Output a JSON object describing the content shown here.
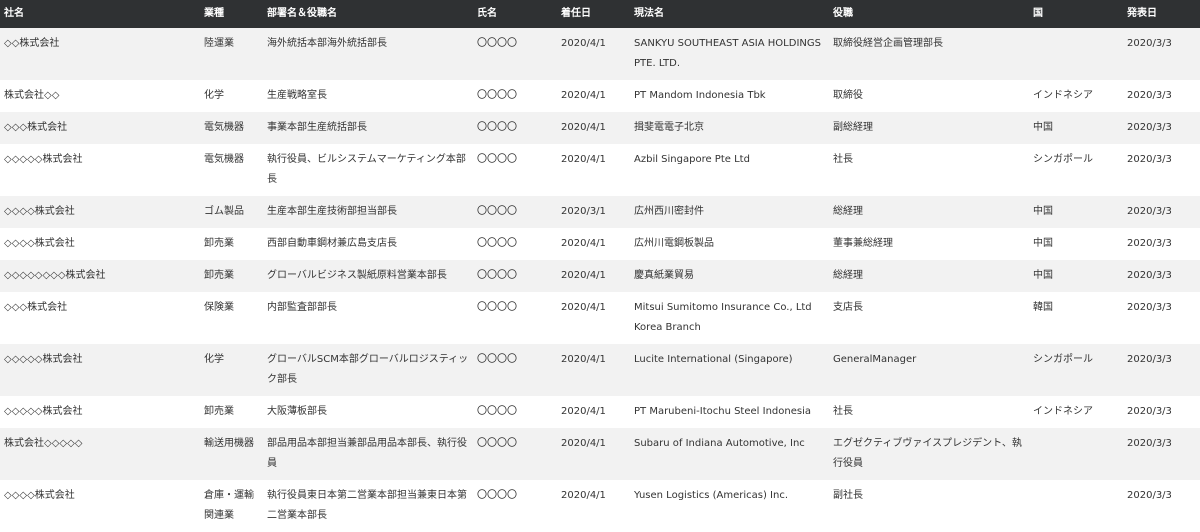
{
  "table": {
    "headers": [
      "社名",
      "業種",
      "部署名＆役職名",
      "氏名",
      "着任日",
      "現法名",
      "役職",
      "国",
      "発表日"
    ],
    "rows": [
      [
        "◇◇株式会社",
        "陸運業",
        "海外統括本部海外統括部長",
        "〇〇〇〇",
        "2020/4/1",
        "SANKYU SOUTHEAST ASIA HOLDINGS PTE. LTD.",
        "取締役経営企画管理部長",
        "",
        "2020/3/3"
      ],
      [
        "株式会社◇◇",
        "化学",
        "生産戦略室長",
        "〇〇〇〇",
        "2020/4/1",
        "PT Mandom Indonesia Tbk",
        "取締役",
        "インドネシア",
        "2020/3/3"
      ],
      [
        "◇◇◇株式会社",
        "電気機器",
        "事業本部生産統括部長",
        "〇〇〇〇",
        "2020/4/1",
        "揖斐電電子北京",
        "副総経理",
        "中国",
        "2020/3/3"
      ],
      [
        "◇◇◇◇◇株式会社",
        "電気機器",
        "執行役員、ビルシステムマーケティング本部長",
        "〇〇〇〇",
        "2020/4/1",
        "Azbil Singapore Pte Ltd",
        "社長",
        "シンガポール",
        "2020/3/3"
      ],
      [
        "◇◇◇◇株式会社",
        "ゴム製品",
        "生産本部生産技術部担当部長",
        "〇〇〇〇",
        "2020/3/1",
        "広州西川密封件",
        "総経理",
        "中国",
        "2020/3/3"
      ],
      [
        "◇◇◇◇株式会社",
        "卸売業",
        "西部自動車鋼材兼広島支店長",
        "〇〇〇〇",
        "2020/4/1",
        "広州川電鋼板製品",
        "董事兼総経理",
        "中国",
        "2020/3/3"
      ],
      [
        "◇◇◇◇◇◇◇◇株式会社",
        "卸売業",
        "グローバルビジネス製紙原料営業本部長",
        "〇〇〇〇",
        "2020/4/1",
        "慶真紙業貿易",
        "総経理",
        "中国",
        "2020/3/3"
      ],
      [
        "◇◇◇株式会社",
        "保険業",
        "内部監査部部長",
        "〇〇〇〇",
        "2020/4/1",
        "Mitsui Sumitomo Insurance Co., Ltd Korea Branch",
        "支店長",
        "韓国",
        "2020/3/3"
      ],
      [
        "◇◇◇◇◇株式会社",
        "化学",
        "グローバルSCM本部グローバルロジスティック部長",
        "〇〇〇〇",
        "2020/4/1",
        "Lucite International (Singapore)",
        "GeneralManager",
        "シンガポール",
        "2020/3/3"
      ],
      [
        "◇◇◇◇◇株式会社",
        "卸売業",
        "大阪薄板部長",
        "〇〇〇〇",
        "2020/4/1",
        "PT Marubeni-Itochu Steel Indonesia",
        "社長",
        "インドネシア",
        "2020/3/3"
      ],
      [
        "株式会社◇◇◇◇◇",
        "輸送用機器",
        "部品用品本部担当兼部品用品本部長、執行役員",
        "〇〇〇〇",
        "2020/4/1",
        "Subaru of Indiana Automotive, Inc",
        "エグゼクティブヴァイスプレジデント、執行役員",
        "",
        "2020/3/3"
      ],
      [
        "◇◇◇◇株式会社",
        "倉庫・運輸関連業",
        "執行役員東日本第二営業本部担当兼東日本第二営業本部長",
        "〇〇〇〇",
        "2020/4/1",
        "Yusen Logistics (Americas) Inc.",
        "副社長",
        "",
        "2020/3/3"
      ]
    ]
  }
}
